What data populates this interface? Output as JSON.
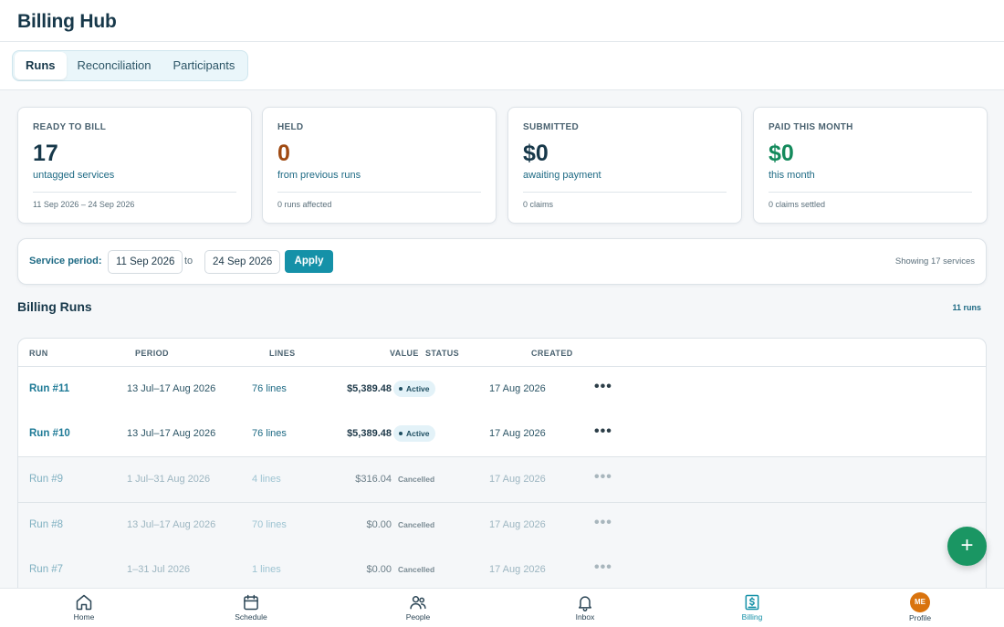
{
  "app": {
    "title": "Billing Hub"
  },
  "tabs": [
    {
      "label": "Runs",
      "active": true
    },
    {
      "label": "Reconciliation",
      "active": false
    },
    {
      "label": "Participants",
      "active": false
    }
  ],
  "stats": [
    {
      "label": "READY TO BILL",
      "value": "17",
      "sub": "untagged services",
      "footer": "11 Sep 2026 – 24 Sep 2026",
      "value_color": "#17384a",
      "sub_color": "#1e6a84"
    },
    {
      "label": "HELD",
      "value": "0",
      "sub": "from previous runs",
      "footer": "0 runs affected",
      "value_color": "#a04a12",
      "sub_color": "#1e6a84"
    },
    {
      "label": "SUBMITTED",
      "value": "$0",
      "sub": "awaiting payment",
      "footer": "0 claims",
      "value_color": "#17384a",
      "sub_color": "#1e6a84"
    },
    {
      "label": "PAID THIS MONTH",
      "value": "$0",
      "sub": "this month",
      "footer": "0 claims settled",
      "value_color": "#148a5c",
      "sub_color": "#1e6a84"
    }
  ],
  "filter": {
    "label": "Service period:",
    "from": "11 Sep 2026",
    "to_label": "to",
    "to": "24 Sep 2026",
    "apply_label": "Apply",
    "showing": "Showing 17 services"
  },
  "runs_section": {
    "title": "Billing Runs",
    "count": "11 runs"
  },
  "table": {
    "columns": [
      "RUN",
      "PERIOD",
      "LINES",
      "VALUE",
      "STATUS",
      "CREATED"
    ],
    "rows": [
      {
        "run": "Run #11",
        "period": "13 Jul–17 Aug 2026",
        "lines": "76 lines",
        "value": "$5,389.48",
        "status": "Active",
        "created": "17 Aug 2026",
        "more": "•••"
      },
      {
        "run": "Run #10",
        "period": "13 Jul–17 Aug 2026",
        "lines": "76 lines",
        "value": "$5,389.48",
        "status": "Active",
        "created": "17 Aug 2026",
        "more": "•••"
      },
      {
        "run": "Run #9",
        "period": "1 Jul–31 Aug 2026",
        "lines": "4 lines",
        "value": "$316.04",
        "status": "Cancelled",
        "created": "17 Aug 2026",
        "more": "•••"
      },
      {
        "run": "Run #8",
        "period": "13 Jul–17 Aug 2026",
        "lines": "70 lines",
        "value": "$0.00",
        "status": "Cancelled",
        "created": "17 Aug 2026",
        "more": "•••"
      },
      {
        "run": "Run #7",
        "period": "1–31 Jul 2026",
        "lines": "1 lines",
        "value": "$0.00",
        "status": "Cancelled",
        "created": "17 Aug 2026",
        "more": "•••"
      }
    ]
  },
  "fab": {
    "icon": "plus-icon",
    "symbol": "+"
  },
  "nav": [
    {
      "label": "Home",
      "icon": "home-icon",
      "active": false
    },
    {
      "label": "Schedule",
      "icon": "calendar-icon",
      "active": false
    },
    {
      "label": "People",
      "icon": "people-icon",
      "active": false
    },
    {
      "label": "Inbox",
      "icon": "bell-icon",
      "active": false
    },
    {
      "label": "Billing",
      "icon": "billing-icon",
      "active": true
    },
    {
      "label": "Profile",
      "icon": "avatar",
      "active": false,
      "initials": "ME"
    }
  ]
}
